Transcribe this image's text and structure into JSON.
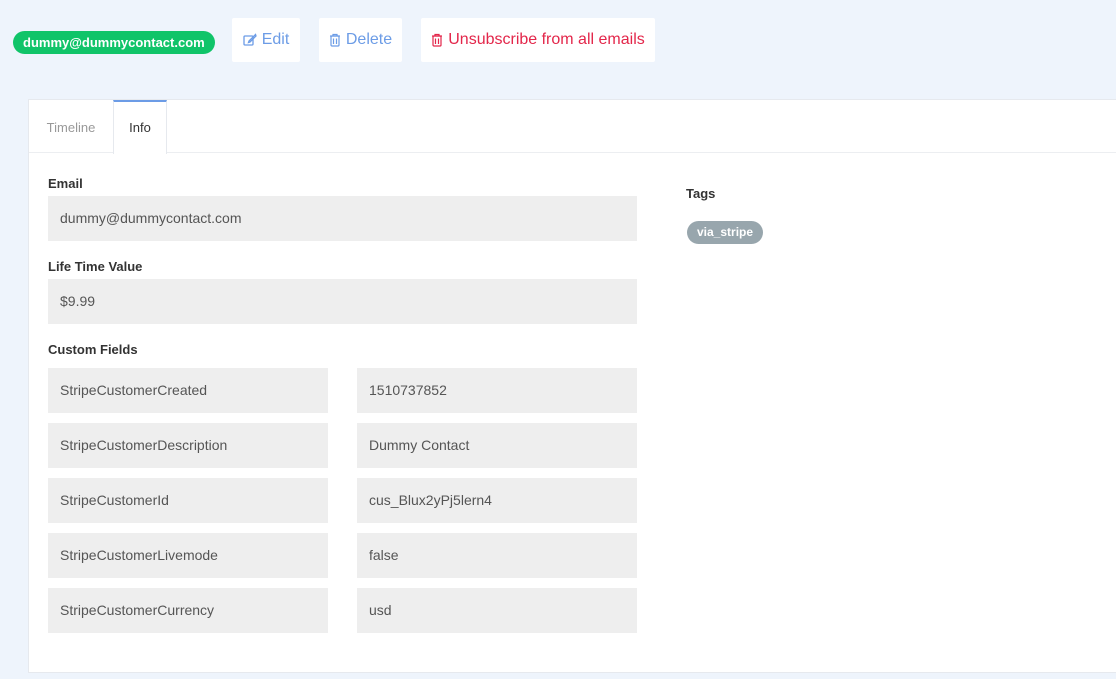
{
  "contact": {
    "email_badge": "dummy@dummycontact.com"
  },
  "actions": {
    "edit_label": "Edit",
    "delete_label": "Delete",
    "unsubscribe_label": "Unsubscribe from all emails"
  },
  "tabs": [
    {
      "label": "Timeline",
      "active": false
    },
    {
      "label": "Info",
      "active": true
    }
  ],
  "info": {
    "email_label": "Email",
    "email_value": "dummy@dummycontact.com",
    "ltv_label": "Life Time Value",
    "ltv_value": "$9.99",
    "custom_fields_label": "Custom Fields",
    "custom_fields": [
      {
        "key": "StripeCustomerCreated",
        "value": "1510737852"
      },
      {
        "key": "StripeCustomerDescription",
        "value": "Dummy Contact"
      },
      {
        "key": "StripeCustomerId",
        "value": "cus_Blux2yPj5lern4"
      },
      {
        "key": "StripeCustomerLivemode",
        "value": "false"
      },
      {
        "key": "StripeCustomerCurrency",
        "value": "usd"
      }
    ],
    "tags_label": "Tags",
    "tags": [
      "via_stripe"
    ]
  },
  "colors": {
    "badge_green": "#10c469",
    "link_blue": "#6c9ce6",
    "danger_red": "#e3264a",
    "tag_gray": "#98a6ad",
    "field_bg": "#eeeeee",
    "page_bg": "#eef4fc"
  },
  "icons": {
    "edit": "edit-icon",
    "delete": "trash-icon",
    "unsubscribe": "trash-icon"
  }
}
